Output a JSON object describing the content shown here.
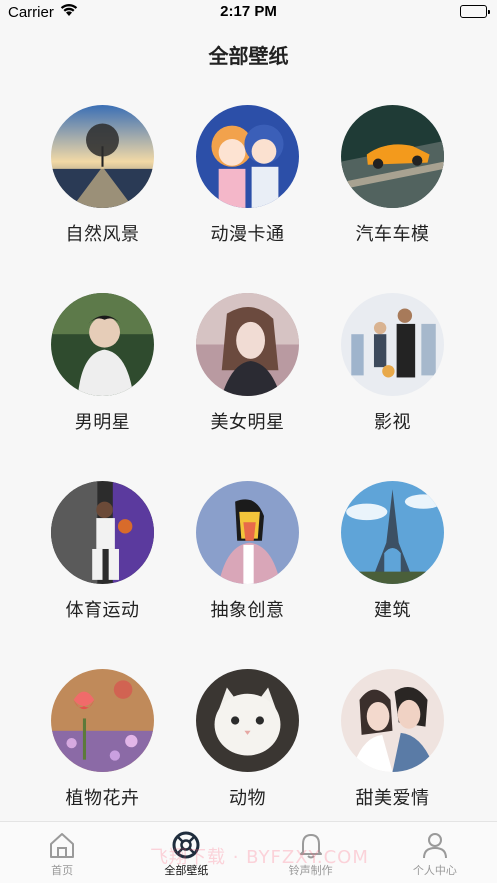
{
  "status_bar": {
    "carrier": "Carrier",
    "time": "2:17 PM"
  },
  "nav": {
    "title": "全部壁纸"
  },
  "categories": [
    {
      "label": "自然风景",
      "icon": "nature-thumbnail"
    },
    {
      "label": "动漫卡通",
      "icon": "anime-thumbnail"
    },
    {
      "label": "汽车车模",
      "icon": "car-thumbnail"
    },
    {
      "label": "男明星",
      "icon": "male-star-thumbnail"
    },
    {
      "label": "美女明星",
      "icon": "female-star-thumbnail"
    },
    {
      "label": "影视",
      "icon": "movie-thumbnail"
    },
    {
      "label": "体育运动",
      "icon": "sports-thumbnail"
    },
    {
      "label": "抽象创意",
      "icon": "abstract-thumbnail"
    },
    {
      "label": "建筑",
      "icon": "architecture-thumbnail"
    },
    {
      "label": "植物花卉",
      "icon": "flower-thumbnail"
    },
    {
      "label": "动物",
      "icon": "animal-thumbnail"
    },
    {
      "label": "甜美爱情",
      "icon": "love-thumbnail"
    }
  ],
  "tab_bar": {
    "tabs": [
      {
        "label": "首页",
        "icon": "home-icon"
      },
      {
        "label": "全部壁纸",
        "icon": "wallpaper-icon",
        "active": true
      },
      {
        "label": "铃声制作",
        "icon": "bell-icon"
      },
      {
        "label": "个人中心",
        "icon": "person-icon"
      }
    ],
    "watermark": "飞翔下载 · BYFZXY.COM"
  },
  "colors": {
    "active_tab": "#1f2d3d",
    "inactive_tab": "#9a9a9a"
  }
}
